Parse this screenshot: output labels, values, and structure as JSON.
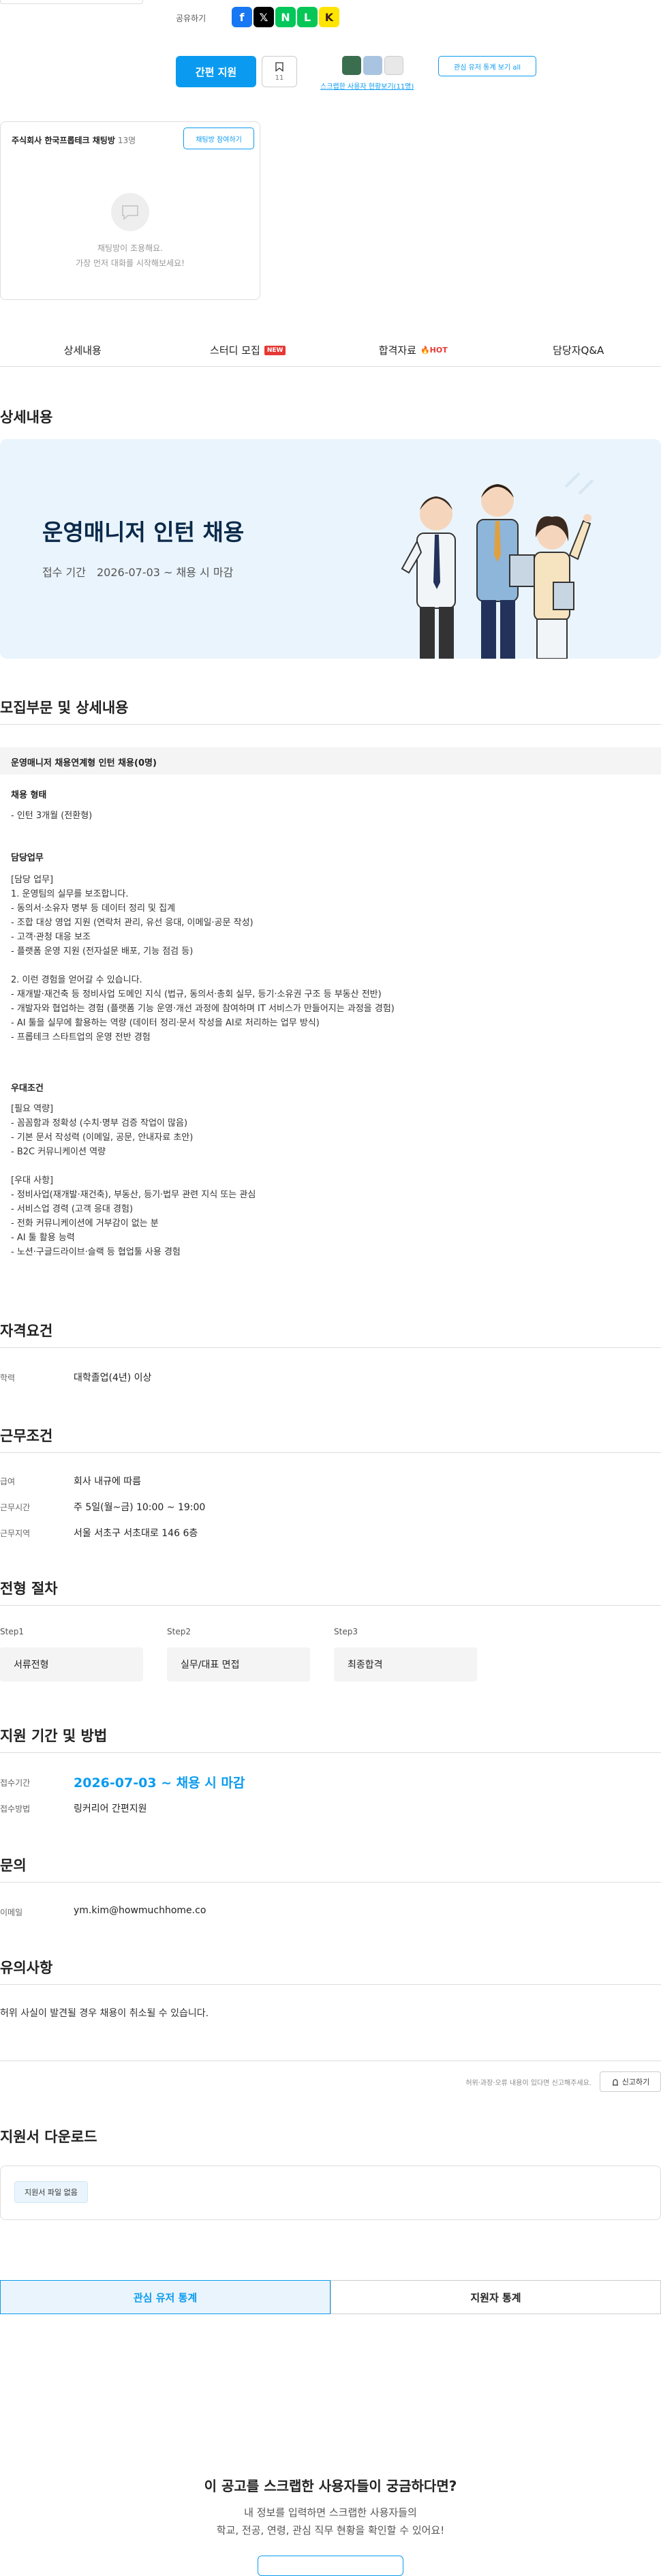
{
  "share": {
    "label": "공유하기",
    "icons": [
      {
        "name": "facebook-icon",
        "glyph": "f",
        "color": "#1877f2"
      },
      {
        "name": "x-icon",
        "glyph": "𝕏",
        "color": "#000000"
      },
      {
        "name": "naver-icon",
        "glyph": "N",
        "color": "#03c75a"
      },
      {
        "name": "line-icon",
        "glyph": "L",
        "color": "#06c755"
      },
      {
        "name": "kakao-icon",
        "glyph": "K",
        "color": "#fee500"
      }
    ]
  },
  "actions": {
    "apply_label": "간편 지원",
    "bookmark_count": "11",
    "scrap_link": "스크랩한 사용자 현황보기(11명)",
    "stats_label": "관심 유저 통계 보기 all"
  },
  "chat": {
    "title": "주식회사 한국프롭테크 채팅방",
    "count": "13명",
    "join_label": "채팅방 참여하기",
    "empty_line1": "채팅방이 조용해요.",
    "empty_line2": "가장 먼저 대화를 시작해보세요!"
  },
  "tabs": {
    "detail": "상세내용",
    "study": "스터디 모집",
    "new_badge": "NEW",
    "pass": "합격자료",
    "hot_badge": "🔥HOT",
    "qa": "담당자Q&A"
  },
  "detail": {
    "heading": "상세내용",
    "banner_title": "운영매니저 인턴 채용",
    "banner_period_label": "접수 기간",
    "banner_period": "2026-07-03 ~ 채용 시 마감"
  },
  "recruit": {
    "heading": "모집부문 및 상세내용",
    "position": "운영매니저 채용연계형 인턴 채용(0명)",
    "employment_label": "채용 형태",
    "employment_value": "- 인턴 3개월 (전환형)",
    "duties_label": "담당업무",
    "duties": "[담당 업무]\n1. 운영팀의 실무를 보조합니다.\n- 동의서·소유자 명부 등 데이터 정리 및 집계\n- 조합 대상 영업 지원 (연락처 관리, 유선 응대, 이메일·공문 작성)\n- 고객·관청 대응 보조\n- 플랫폼 운영 지원 (전자설문 배포, 기능 점검 등)\n\n2. 이런 경험을 얻어갈 수 있습니다.\n- 재개발·재건축 등 정비사업 도메인 지식 (법규, 동의서·총회 실무, 등기·소유권 구조 등 부동산 전반)\n- 개발자와 협업하는 경험 (플랫폼 기능 운영·개선 과정에 참여하며 IT 서비스가 만들어지는 과정을 경험)\n- AI 툴을 실무에 활용하는 역량 (데이터 정리·문서 작성을 AI로 처리하는 업무 방식)\n- 프롭테크 스타트업의 운영 전반 경험",
    "pref_label": "우대조건",
    "pref": "[필요 역량]\n- 꼼꼼함과 정확성 (수치·명부 검증 작업이 많음)\n- 기본 문서 작성력 (이메일, 공문, 안내자료 초안)\n- B2C 커뮤니케이션 역량\n\n[우대 사항]\n- 정비사업(재개발·재건축), 부동산, 등기·법무 관련 지식 또는 관심\n- 서비스업 경력 (고객 응대 경험)\n- 전화 커뮤니케이션에 거부감이 없는 분\n- AI 툴 활용 능력\n- 노션·구글드라이브·슬랙 등 협업툴 사용 경험"
  },
  "qualification": {
    "heading": "자격요건",
    "edu_label": "학력",
    "edu_value": "대학졸업(4년) 이상"
  },
  "conditions": {
    "heading": "근무조건",
    "salary_label": "급여",
    "salary_value": "회사 내규에 따름",
    "hours_label": "근무시간",
    "hours_value": "주 5일(월~금) 10:00 ~ 19:00",
    "location_label": "근무지역",
    "location_value": "서울 서초구 서초대로 146 6층"
  },
  "process": {
    "heading": "전형 절차",
    "steps": [
      {
        "label": "Step1",
        "name": "서류전형"
      },
      {
        "label": "Step2",
        "name": "실무/대표 면접"
      },
      {
        "label": "Step3",
        "name": "최종합격"
      }
    ]
  },
  "period": {
    "heading": "지원 기간 및 방법",
    "date_label": "접수기간",
    "date_value": "2026-07-03 ~ 채용 시 마감",
    "method_label": "접수방법",
    "method_value": "링커리어 간편지원"
  },
  "contact": {
    "heading": "문의",
    "email_label": "이메일",
    "email_value": "ym.kim@howmuchhome.co"
  },
  "notes": {
    "heading": "유의사항",
    "text": "허위 사실이 발견될 경우 채용이 취소될 수 있습니다.",
    "report_text": "허위·과장·오류 내용이 있다면 신고해주세요.",
    "report_btn": "신고하기"
  },
  "download": {
    "heading": "지원서 다운로드",
    "chip": "지원서 파일 없음"
  },
  "bottom_tabs": {
    "interest": "관심 유저 통계",
    "applicants": "지원자 통계"
  },
  "cta": {
    "title": "이 공고를 스크랩한 사용자들이 궁금하다면?",
    "line1": "내 정보를 입력하면 스크랩한 사용자들의",
    "line2": "학교, 전공, 연령, 관심 직무 현황을 확인할 수 있어요!"
  },
  "colors": {
    "accent": "#0a9bf0",
    "hot": "#e53935"
  }
}
